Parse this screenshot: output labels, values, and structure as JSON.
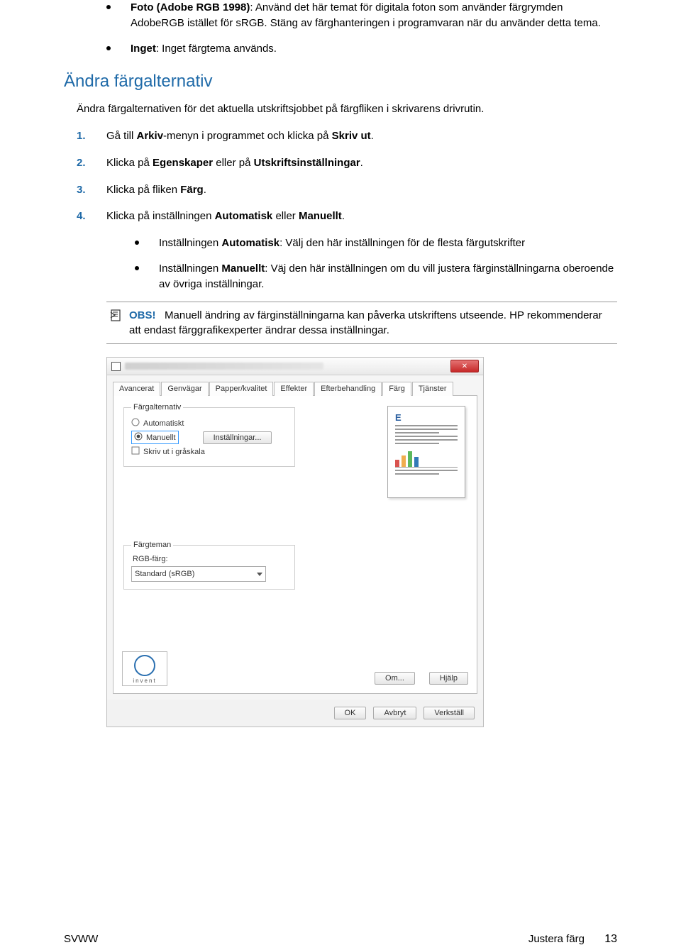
{
  "bullets_top": [
    {
      "bold": "Foto (Adobe RGB 1998)",
      "rest": ": Använd det här temat för digitala foton som använder färgrymden AdobeRGB istället för sRGB. Stäng av färghanteringen i programvaran när du använder detta tema."
    },
    {
      "bold": "Inget",
      "rest": ": Inget färgtema används."
    }
  ],
  "section_title": "Ändra färgalternativ",
  "intro": "Ändra färgalternativen för det aktuella utskriftsjobbet på färgfliken i skrivarens drivrutin.",
  "steps": [
    {
      "n": "1.",
      "pre": "Gå till ",
      "b": "Arkiv",
      "post": "-menyn i programmet och klicka på ",
      "b2": "Skriv ut",
      "post2": "."
    },
    {
      "n": "2.",
      "pre": "Klicka på ",
      "b": "Egenskaper",
      "post": " eller på ",
      "b2": "Utskriftsinställningar",
      "post2": "."
    },
    {
      "n": "3.",
      "pre": "Klicka på fliken ",
      "b": "Färg",
      "post": ".",
      "b2": "",
      "post2": ""
    },
    {
      "n": "4.",
      "pre": "Klicka på inställningen ",
      "b": "Automatisk",
      "post": " eller ",
      "b2": "Manuellt",
      "post2": "."
    }
  ],
  "sub_bullets": [
    {
      "pre": "Inställningen ",
      "b": "Automatisk",
      "post": ": Välj den här inställningen för de flesta färgutskrifter"
    },
    {
      "pre": "Inställningen ",
      "b": "Manuellt",
      "post": ": Väj den här inställningen om du vill justera färginställningarna oberoende av övriga inställningar."
    }
  ],
  "note": {
    "label": "OBS!",
    "text": "Manuell ändring av färginställningarna kan påverka utskriftens utseende. HP rekommenderar att endast färggrafikexperter ändrar dessa inställningar."
  },
  "dialog": {
    "tabs": [
      "Avancerat",
      "Genvägar",
      "Papper/kvalitet",
      "Effekter",
      "Efterbehandling",
      "Färg",
      "Tjänster"
    ],
    "selected_tab": "Färg",
    "group1_title": "Färgalternativ",
    "radio_auto": "Automatiskt",
    "radio_manual": "Manuellt",
    "settings_btn": "Inställningar...",
    "chk_grayscale": "Skriv ut i gråskala",
    "group2_title": "Färgteman",
    "rgb_label": "RGB-färg:",
    "rgb_value": "Standard (sRGB)",
    "preview_letter": "E",
    "hp_text": "invent",
    "btn_om": "Om...",
    "btn_help": "Hjälp",
    "btn_ok": "OK",
    "btn_cancel": "Avbryt",
    "btn_apply": "Verkställ"
  },
  "footer": {
    "left": "SVWW",
    "right": "Justera färg",
    "page": "13"
  }
}
